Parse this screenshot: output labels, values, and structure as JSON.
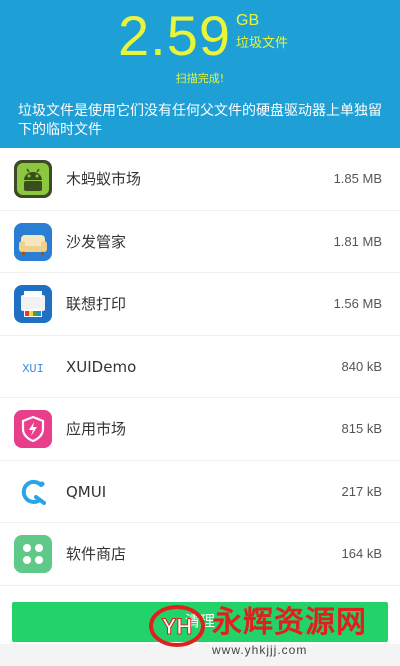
{
  "summary": {
    "size_value": "2.59",
    "size_unit": "GB",
    "size_caption": "垃圾文件",
    "scan_status": "扫描完成!",
    "description": "垃圾文件是使用它们没有任何父文件的硬盘驱动器上单独留下的临时文件"
  },
  "apps": [
    {
      "name": "木蚂蚁市场",
      "size": "1.85 MB",
      "icon": "android-market-icon"
    },
    {
      "name": "沙发管家",
      "size": "1.81 MB",
      "icon": "sofa-icon"
    },
    {
      "name": "联想打印",
      "size": "1.56 MB",
      "icon": "printer-icon"
    },
    {
      "name": "XUIDemo",
      "size": "840 kB",
      "icon": "xui-icon",
      "icon_text": "XUI"
    },
    {
      "name": "应用市场",
      "size": "815 kB",
      "icon": "shield-bolt-icon"
    },
    {
      "name": "QMUI",
      "size": "217 kB",
      "icon": "qmui-logo-icon"
    },
    {
      "name": "软件商店",
      "size": "164 kB",
      "icon": "app-store-icon"
    }
  ],
  "clean_button": {
    "label": "清理"
  },
  "watermark": {
    "text": "永辉资源网",
    "url": "www.yhkjjj.com",
    "logo_text": "YH"
  },
  "colors": {
    "header_bg": "#1e9fd6",
    "accent_yellow": "#e8f53a",
    "button_green": "#22d36a",
    "watermark_red": "#e0201c"
  }
}
